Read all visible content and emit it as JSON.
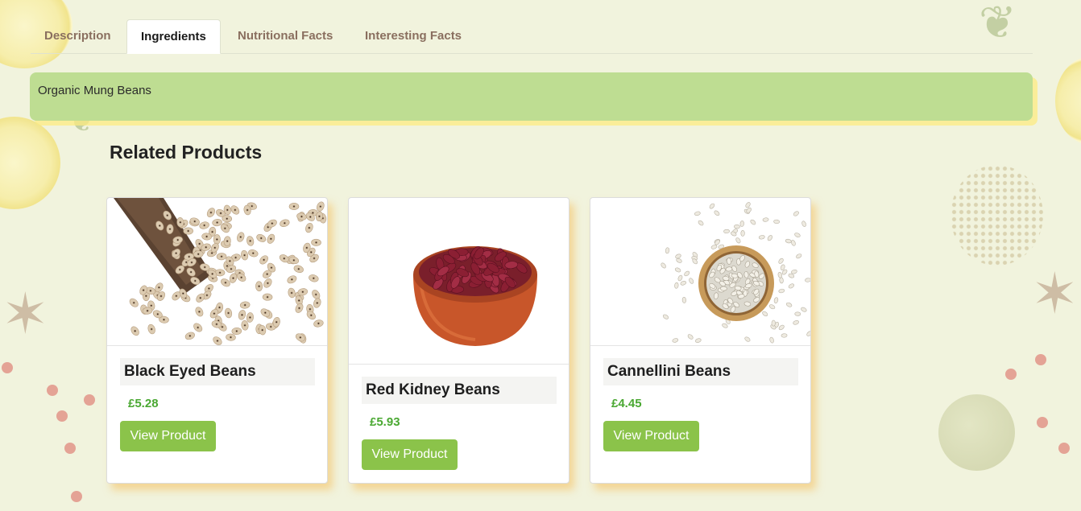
{
  "tabs": [
    {
      "label": "Description",
      "active": false
    },
    {
      "label": "Ingredients",
      "active": true
    },
    {
      "label": "Nutritional Facts",
      "active": false
    },
    {
      "label": "Interesting Facts",
      "active": false
    }
  ],
  "panel": {
    "text": "Organic Mung Beans"
  },
  "related": {
    "title": "Related Products",
    "products": [
      {
        "name": "Black Eyed Beans",
        "price": "£5.28",
        "button": "View Product",
        "image_icon": "black-eyed-beans-scoop"
      },
      {
        "name": "Red Kidney Beans",
        "price": "£5.93",
        "button": "View Product",
        "image_icon": "red-kidney-beans-bowl"
      },
      {
        "name": "Cannellini Beans",
        "price": "£4.45",
        "button": "View Product",
        "image_icon": "cannellini-beans-bowl"
      }
    ]
  },
  "colors": {
    "accent_green": "#8bc34a",
    "price_green": "#4aa832",
    "panel_bg": "#bedd92",
    "page_bg": "#f1f3dd"
  }
}
